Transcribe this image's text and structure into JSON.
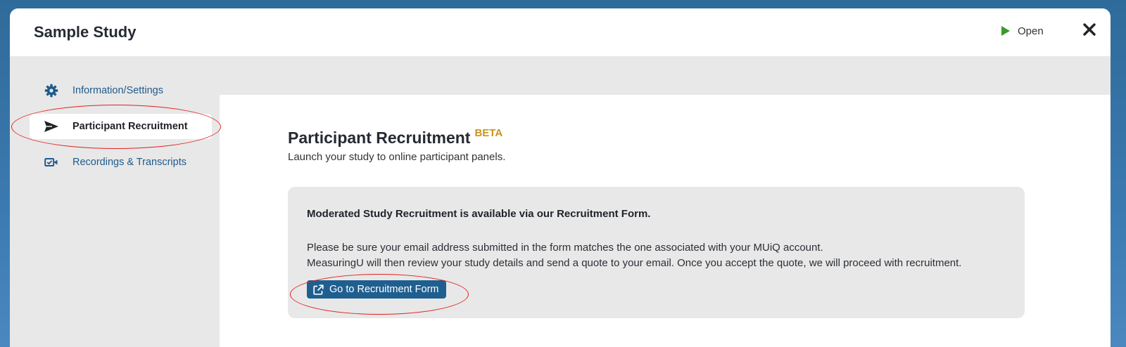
{
  "modal": {
    "title": "Sample Study",
    "open_label": "Open",
    "open_icon": "play-icon",
    "close_icon": "close-icon"
  },
  "sidebar": {
    "items": [
      {
        "label": "Information/Settings",
        "icon": "gear-icon",
        "active": false
      },
      {
        "label": "Participant Recruitment",
        "icon": "paper-plane-icon",
        "active": true
      },
      {
        "label": "Recordings & Transcripts",
        "icon": "video-check-icon",
        "active": false
      }
    ]
  },
  "main": {
    "heading": "Participant Recruitment",
    "badge": "BETA",
    "subtitle": "Launch your study to online participant panels.",
    "info_box": {
      "title": "Moderated Study Recruitment is available via our Recruitment Form.",
      "line_1": "Please be sure your email address submitted in the form matches the one associated with your MUiQ account.",
      "line_2": "MeasuringU will then review your study details and send a quote to your email. Once you accept the quote, we will proceed with recruitment.",
      "button_label": "Go to Recruitment Form",
      "button_icon": "external-link-icon"
    }
  },
  "colors": {
    "accent_blue": "#1f5f8f",
    "link_blue": "#1f5a8c",
    "beta_gold": "#c8951a",
    "play_green": "#3a9a2a",
    "annotation_red": "#e02020"
  }
}
